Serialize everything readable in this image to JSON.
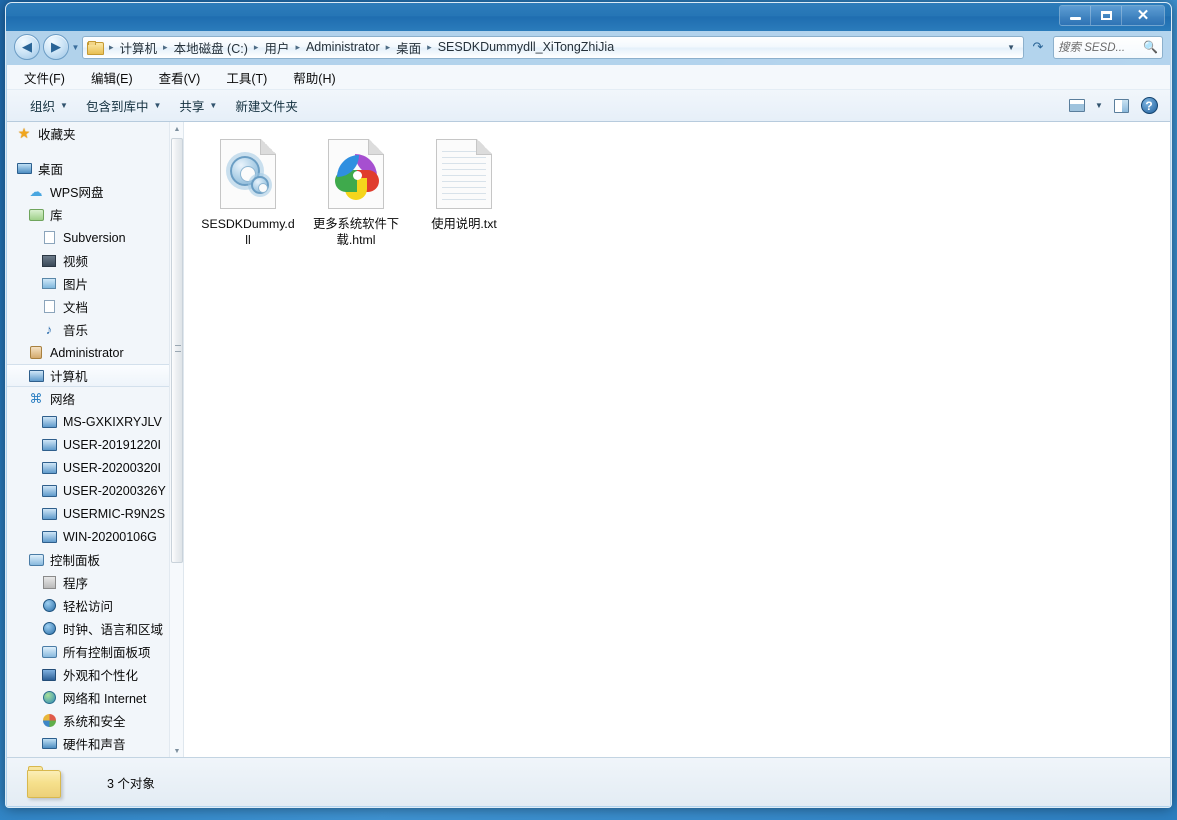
{
  "window": {
    "title": "SESDKDummydll_XiTongZhiJia",
    "controls": [
      {
        "name": "minimize",
        "label": "–"
      },
      {
        "name": "maximize",
        "label": "□"
      },
      {
        "name": "close",
        "label": "✕"
      }
    ]
  },
  "address": {
    "back_label": "◀",
    "forward_label": "▶",
    "nav_dropdown_label": "▼",
    "folder_icon": "folder-icon",
    "breadcrumbs": [
      "计算机",
      "本地磁盘 (C:)",
      "用户",
      "Administrator",
      "桌面",
      "SESDKDummydll_XiTongZhiJia"
    ],
    "separator": "▸",
    "caret_label": "▼",
    "refresh_label": "↻"
  },
  "search": {
    "value": "搜索 SESD...",
    "icon": "search-icon"
  },
  "menu": {
    "items": [
      "文件(F)",
      "编辑(E)",
      "查看(V)",
      "工具(T)",
      "帮助(H)"
    ]
  },
  "toolbar": {
    "buttons": [
      {
        "label": "组织",
        "caret": "▼"
      },
      {
        "label": "包含到库中",
        "caret": "▼"
      },
      {
        "label": "共享",
        "caret": "▼"
      },
      {
        "label": "新建文件夹",
        "caret": ""
      }
    ],
    "view_caret": "▼",
    "help_label": "?"
  },
  "sidebar": {
    "items": [
      {
        "label": "收藏夹",
        "icon": "star-icon",
        "level": 0,
        "selected": false,
        "spacer_after": true
      },
      {
        "label": "桌面",
        "icon": "monitor-icon",
        "level": 0,
        "selected": false
      },
      {
        "label": "WPS网盘",
        "icon": "cloud-icon",
        "level": 1,
        "selected": false
      },
      {
        "label": "库",
        "icon": "library-icon",
        "level": 1,
        "selected": false
      },
      {
        "label": "Subversion",
        "icon": "document-icon",
        "level": 2,
        "selected": false
      },
      {
        "label": "视频",
        "icon": "video-icon",
        "level": 2,
        "selected": false
      },
      {
        "label": "图片",
        "icon": "picture-icon",
        "level": 2,
        "selected": false
      },
      {
        "label": "文档",
        "icon": "document-icon",
        "level": 2,
        "selected": false
      },
      {
        "label": "音乐",
        "icon": "music-icon",
        "level": 2,
        "selected": false
      },
      {
        "label": "Administrator",
        "icon": "user-icon",
        "level": 1,
        "selected": false
      },
      {
        "label": "计算机",
        "icon": "computer-icon",
        "level": 1,
        "selected": true
      },
      {
        "label": "网络",
        "icon": "network-icon",
        "level": 1,
        "selected": false
      },
      {
        "label": "MS-GXKIXRYJLV",
        "icon": "computer-icon",
        "level": 2,
        "selected": false
      },
      {
        "label": "USER-20191220I",
        "icon": "computer-icon",
        "level": 2,
        "selected": false
      },
      {
        "label": "USER-20200320I",
        "icon": "computer-icon",
        "level": 2,
        "selected": false
      },
      {
        "label": "USER-20200326Y",
        "icon": "computer-icon",
        "level": 2,
        "selected": false
      },
      {
        "label": "USERMIC-R9N2S",
        "icon": "computer-icon",
        "level": 2,
        "selected": false
      },
      {
        "label": "WIN-20200106G",
        "icon": "computer-icon",
        "level": 2,
        "selected": false
      },
      {
        "label": "控制面板",
        "icon": "control-panel-icon",
        "level": 1,
        "selected": false
      },
      {
        "label": "程序",
        "icon": "programs-icon",
        "level": 2,
        "selected": false
      },
      {
        "label": "轻松访问",
        "icon": "ease-of-access-icon",
        "level": 2,
        "selected": false
      },
      {
        "label": "时钟、语言和区域",
        "icon": "clock-icon",
        "level": 2,
        "selected": false
      },
      {
        "label": "所有控制面板项",
        "icon": "control-panel-icon",
        "level": 2,
        "selected": false
      },
      {
        "label": "外观和个性化",
        "icon": "appearance-icon",
        "level": 2,
        "selected": false
      },
      {
        "label": "网络和 Internet",
        "icon": "globe-icon",
        "level": 2,
        "selected": false
      },
      {
        "label": "系统和安全",
        "icon": "shield-icon",
        "level": 2,
        "selected": false
      },
      {
        "label": "硬件和声音",
        "icon": "monitor-icon",
        "level": 2,
        "selected": false
      }
    ],
    "scroll_up_label": "▲",
    "scroll_down_label": "▼"
  },
  "files": [
    {
      "name": "SESDKDummy.dll",
      "icon": "dll-file-icon"
    },
    {
      "name": "更多系统软件下载.html",
      "icon": "html-file-icon"
    },
    {
      "name": "使用说明.txt",
      "icon": "text-file-icon"
    }
  ],
  "status": {
    "text": "3 个对象",
    "icon": "folder-icon"
  },
  "colors": {
    "accent": "#2676b6",
    "window_chrome": "#bedaf0",
    "content_bg": "#ffffff",
    "sidebar_bg": "#f2f6fa"
  }
}
